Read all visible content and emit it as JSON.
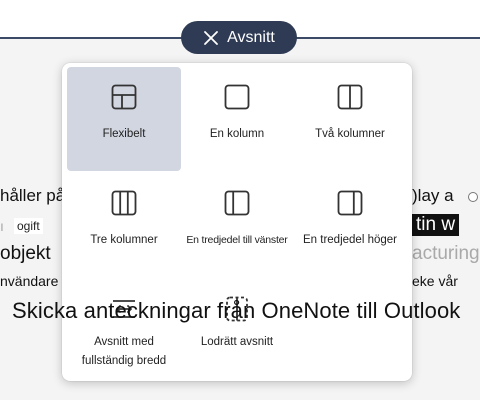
{
  "section_pill": {
    "label": "Avsnitt",
    "icon": "close-icon"
  },
  "background": {
    "line1_left": "håller på att",
    "line1_right": ")lay a",
    "chip": "ogift",
    "dark_block": "tin w",
    "line3_left": "objekt",
    "line3_right_gray": "acturing",
    "line4_left": "nvändare t",
    "line4_right": "eke vår"
  },
  "layout_options": [
    {
      "label": "Flexibelt",
      "icon": "flexible-layout-icon",
      "selected": true
    },
    {
      "label": "En kolumn",
      "icon": "one-column-icon",
      "selected": false
    },
    {
      "label": "Två kolumner",
      "icon": "two-columns-icon",
      "selected": false
    },
    {
      "label": "Tre kolumner",
      "icon": "three-columns-icon",
      "selected": false
    },
    {
      "label": "En tredjedel till vänster",
      "icon": "one-third-left-icon",
      "selected": false
    },
    {
      "label": "En tredjedel höger",
      "icon": "one-third-right-icon",
      "selected": false
    },
    {
      "label": "Avsnitt med fullständig bredd",
      "icon": "full-width-section-icon",
      "selected": false
    },
    {
      "label": "Lodrätt avsnitt",
      "icon": "vertical-section-icon",
      "selected": false
    }
  ],
  "caption": "Skicka anteckningar från OneNote till Outlook",
  "colors": {
    "pill": "#2f3b55",
    "selected": "#d2d6e0",
    "line": "#3b4a66"
  }
}
